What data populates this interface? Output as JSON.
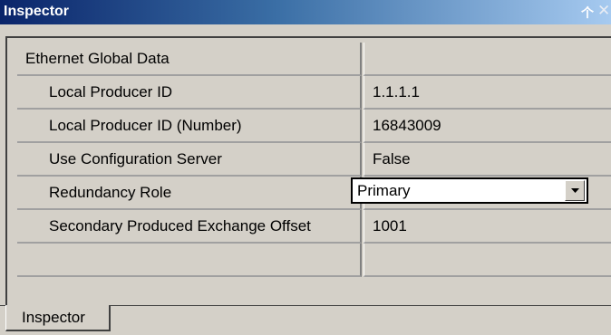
{
  "window": {
    "title": "Inspector",
    "pin_icon": "pin-icon",
    "close_icon": "close-icon"
  },
  "grid": {
    "section": {
      "name": "Ethernet Global Data",
      "value": ""
    },
    "properties": [
      {
        "name": "Local Producer ID",
        "value": "1.1.1.1"
      },
      {
        "name": "Local Producer ID (Number)",
        "value": "16843009"
      },
      {
        "name": "Use Configuration Server",
        "value": "False"
      },
      {
        "name": "Redundancy Role",
        "value": "Primary",
        "control": "dropdown"
      },
      {
        "name": "Secondary Produced Exchange Offset",
        "value": "1001"
      }
    ]
  },
  "tabs": [
    {
      "label": "Inspector",
      "active": true
    }
  ],
  "colors": {
    "title_gradient_start": "#0a246a",
    "title_gradient_end": "#a6caf0",
    "panel_bg": "#d4d0c8",
    "combo_bg": "#ffffff"
  }
}
